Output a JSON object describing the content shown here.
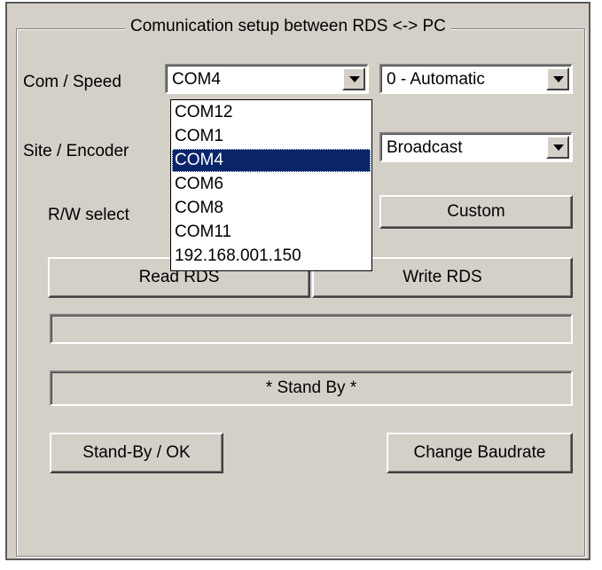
{
  "group_title": "Comunication setup between RDS <-> PC",
  "com_speed": {
    "label": "Com / Speed",
    "com_value": "COM4",
    "speed_value": "0 - Automatic"
  },
  "site_encoder": {
    "label": "Site / Encoder",
    "encoder_value": "Broadcast"
  },
  "rw_select": {
    "label": "R/W select",
    "custom_button": "Custom"
  },
  "com_dropdown": {
    "options": [
      "COM12",
      "COM1",
      "COM4",
      "COM6",
      "COM8",
      "COM11",
      "192.168.001.150"
    ],
    "selected": "COM4"
  },
  "buttons": {
    "read": "Read RDS",
    "write": "Write RDS",
    "standby_ok": "Stand-By / OK",
    "change_baudrate": "Change Baudrate"
  },
  "status_text": "* Stand By *",
  "progress_fraction": 0
}
